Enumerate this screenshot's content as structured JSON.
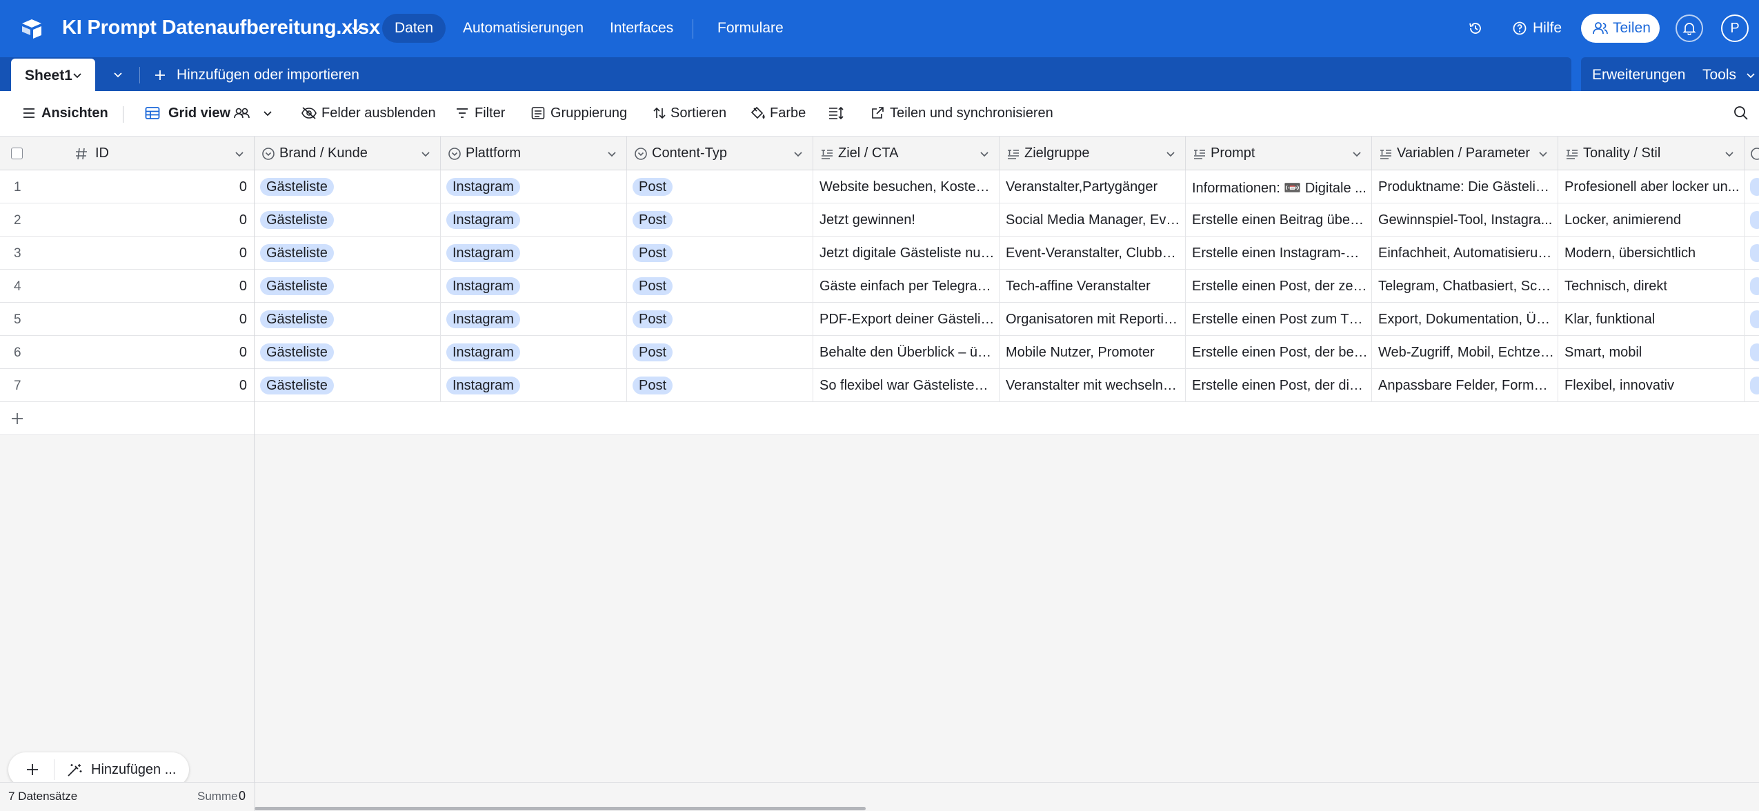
{
  "app": {
    "base_name": "KI Prompt Datenaufbereitung.xlsx",
    "nav": [
      "Daten",
      "Automatisierungen",
      "Interfaces",
      "Formulare"
    ],
    "help": "Hilfe",
    "share": "Teilen",
    "avatar_initial": "P"
  },
  "tabs": {
    "active_sheet": "Sheet1",
    "add_import": "Hinzufügen oder importieren",
    "extensions": "Erweiterungen",
    "tools": "Tools"
  },
  "viewbar": {
    "views": "Ansichten",
    "grid_view": "Grid view",
    "hide_fields": "Felder ausblenden",
    "filter": "Filter",
    "group": "Gruppierung",
    "sort": "Sortieren",
    "color": "Farbe",
    "share_sync": "Teilen und synchronisieren"
  },
  "columns": [
    "ID",
    "Brand / Kunde",
    "Plattform",
    "Content-Typ",
    "Ziel / CTA",
    "Zielgruppe",
    "Prompt",
    "Variablen / Parameter",
    "Tonality / Stil"
  ],
  "rows": [
    {
      "num": "1",
      "id": "0",
      "brand": "Gästeliste",
      "platform": "Instagram",
      "type": "Post",
      "cta": "Website besuchen, Kostenl...",
      "audience": "Veranstalter,Partygänger",
      "prompt": "Informationen: 📼 Digitale ...",
      "vars": "Produktname: Die Gästelist...",
      "tone": "Profesionell aber locker un..."
    },
    {
      "num": "2",
      "id": "0",
      "brand": "Gästeliste",
      "platform": "Instagram",
      "type": "Post",
      "cta": "Jetzt gewinnen!",
      "audience": "Social Media Manager, Eve...",
      "prompt": "Erstelle einen Beitrag über ...",
      "vars": "Gewinnspiel-Tool, Instagra...",
      "tone": "Locker, animierend"
    },
    {
      "num": "3",
      "id": "0",
      "brand": "Gästeliste",
      "platform": "Instagram",
      "type": "Post",
      "cta": "Jetzt digitale Gästeliste nut...",
      "audience": "Event-Veranstalter, Clubbet...",
      "prompt": "Erstelle einen Instagram-Po...",
      "vars": "Einfachheit, Automatisierun...",
      "tone": "Modern, übersichtlich"
    },
    {
      "num": "4",
      "id": "0",
      "brand": "Gästeliste",
      "platform": "Instagram",
      "type": "Post",
      "cta": "Gäste einfach per Telegram...",
      "audience": "Tech-affine Veranstalter",
      "prompt": "Erstelle einen Post, der zeig...",
      "vars": "Telegram, Chatbasiert, Schn...",
      "tone": "Technisch, direkt"
    },
    {
      "num": "5",
      "id": "0",
      "brand": "Gästeliste",
      "platform": "Instagram",
      "type": "Post",
      "cta": "PDF-Export deiner Gästelist...",
      "audience": "Organisatoren mit Reportin...",
      "prompt": "Erstelle einen Post zum The...",
      "vars": "Export, Dokumentation, Üb...",
      "tone": "Klar, funktional"
    },
    {
      "num": "6",
      "id": "0",
      "brand": "Gästeliste",
      "platform": "Instagram",
      "type": "Post",
      "cta": "Behalte den Überblick – üb...",
      "audience": "Mobile Nutzer, Promoter",
      "prompt": "Erstelle einen Post, der bet...",
      "vars": "Web-Zugriff, Mobil, Echtzei...",
      "tone": "Smart, mobil"
    },
    {
      "num": "7",
      "id": "0",
      "brand": "Gästeliste",
      "platform": "Instagram",
      "type": "Post",
      "cta": "So flexibel war Gästelisten-...",
      "audience": "Veranstalter mit wechselnd...",
      "prompt": "Erstelle einen Post, der die ...",
      "vars": "Anpassbare Felder, Formul...",
      "tone": "Flexibel, innovativ"
    }
  ],
  "footer": {
    "records": "7 Datensätze",
    "sum_label": "Summe",
    "sum_value": "0",
    "add_label": "Hinzufügen ..."
  },
  "colors": {
    "brand_blue": "#1a67d9",
    "chip_blue": "#cfe0fd"
  }
}
